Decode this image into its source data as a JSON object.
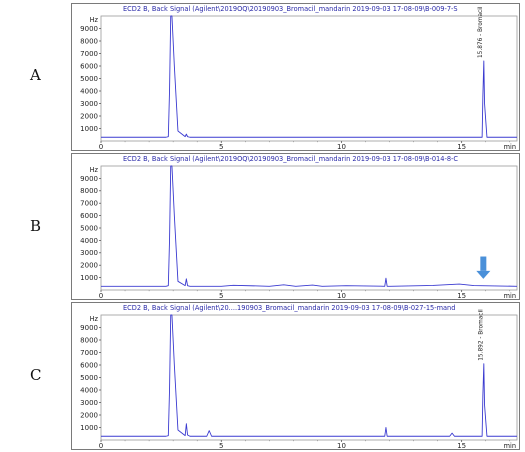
{
  "figure": {
    "panel_labels": [
      "A",
      "B",
      "C"
    ]
  },
  "chart_data": [
    {
      "type": "line",
      "panel": "A",
      "title": "ECD2 B, Back Signal (Agilent\\2019OQ\\20190903_Bromacil_mandarin 2019-09-03 17-08-09\\B-009-7-S",
      "xlabel": "min",
      "ylabel": "Hz",
      "xlim": [
        0,
        17.3
      ],
      "ylim": [
        0,
        10000
      ],
      "xticks": [
        0,
        5,
        10,
        15
      ],
      "yticks": [
        1000,
        2000,
        3000,
        4000,
        5000,
        6000,
        7000,
        8000,
        9000
      ],
      "color": "#3a3ad0",
      "series": [
        {
          "x": [
            0,
            2.7,
            2.8,
            2.85,
            2.9,
            2.95,
            3.05,
            3.2,
            3.5,
            3.55,
            3.6,
            3.7,
            8,
            12,
            15.5,
            15.85,
            15.88,
            15.92,
            15.95,
            16.05,
            17.3
          ],
          "y": [
            300,
            300,
            350,
            4000,
            10000,
            10000,
            6000,
            800,
            350,
            550,
            350,
            300,
            300,
            300,
            300,
            300,
            3500,
            6400,
            3000,
            300,
            300
          ]
        }
      ],
      "peak_labels": [
        {
          "text": "15.876 - Bromacil",
          "x": 15.9,
          "y": 6400
        }
      ],
      "arrows": []
    },
    {
      "type": "line",
      "panel": "B",
      "title": "ECD2 B, Back Signal (Agilent\\2019OQ\\20190903_Bromacil_mandarin 2019-09-03 17-08-09\\B-014-8-C",
      "xlabel": "min",
      "ylabel": "Hz",
      "xlim": [
        0,
        17.3
      ],
      "ylim": [
        0,
        10000
      ],
      "xticks": [
        0,
        5,
        10,
        15
      ],
      "yticks": [
        1000,
        2000,
        3000,
        4000,
        5000,
        6000,
        7000,
        8000,
        9000
      ],
      "color": "#3a3ad0",
      "series": [
        {
          "x": [
            0,
            2.7,
            2.8,
            2.85,
            2.9,
            2.95,
            3.05,
            3.2,
            3.5,
            3.55,
            3.6,
            3.7,
            5,
            5.5,
            7,
            7.6,
            8.1,
            8.8,
            9.2,
            10.2,
            11.8,
            11.85,
            11.9,
            12.0,
            13.8,
            14.9,
            15.5,
            17.3
          ],
          "y": [
            300,
            300,
            350,
            4000,
            10000,
            10000,
            6000,
            700,
            350,
            900,
            350,
            300,
            300,
            380,
            300,
            420,
            300,
            400,
            300,
            350,
            300,
            950,
            300,
            300,
            370,
            480,
            360,
            300
          ]
        }
      ],
      "peak_labels": [],
      "arrows": [
        {
          "x": 15.9,
          "y_top": 2700,
          "y_bottom": 900,
          "color": "#4a90d9"
        }
      ]
    },
    {
      "type": "line",
      "panel": "C",
      "title": "ECD2 B, Back Signal (Agilent\\20....190903_Bromacil_mandarin 2019-09-03 17-08-09\\B-027-15-mand",
      "xlabel": "min",
      "ylabel": "Hz",
      "xlim": [
        0,
        17.3
      ],
      "ylim": [
        0,
        10000
      ],
      "xticks": [
        0,
        5,
        10,
        15
      ],
      "yticks": [
        1000,
        2000,
        3000,
        4000,
        5000,
        6000,
        7000,
        8000,
        9000
      ],
      "color": "#3a3ad0",
      "series": [
        {
          "x": [
            0,
            2.7,
            2.8,
            2.85,
            2.9,
            2.95,
            3.05,
            3.2,
            3.5,
            3.55,
            3.6,
            3.7,
            4.4,
            4.5,
            4.6,
            6,
            10,
            11.8,
            11.85,
            11.9,
            12.0,
            14.5,
            14.6,
            14.7,
            15.6,
            15.85,
            15.88,
            15.92,
            15.95,
            16.05,
            17.3
          ],
          "y": [
            300,
            300,
            350,
            4000,
            10000,
            10000,
            6000,
            800,
            350,
            1300,
            400,
            300,
            300,
            750,
            300,
            300,
            300,
            300,
            1000,
            300,
            300,
            300,
            550,
            300,
            300,
            300,
            3500,
            6100,
            2800,
            300,
            300
          ]
        }
      ],
      "peak_labels": [
        {
          "text": "15.892 - Bromacil",
          "x": 15.92,
          "y": 6100
        }
      ],
      "arrows": []
    }
  ]
}
